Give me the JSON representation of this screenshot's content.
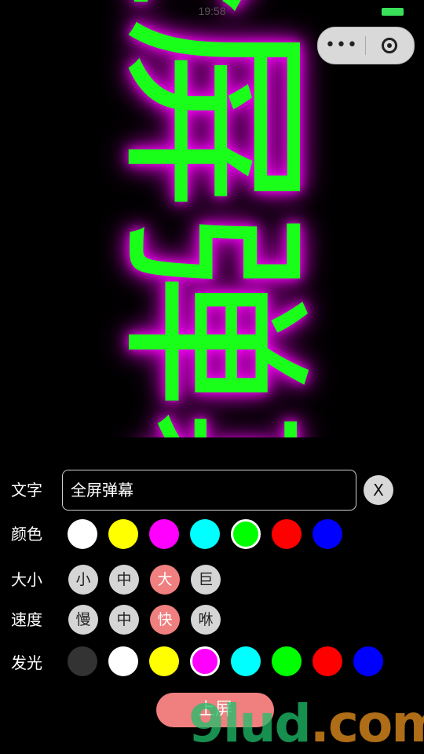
{
  "status": {
    "time": "19:58"
  },
  "preview": {
    "danmaku_text": "全屏弹幕",
    "text_color": "#19ff19",
    "glow_color": "#ff00ff"
  },
  "controls": {
    "text": {
      "label": "文字",
      "value": "全屏弹幕",
      "clear_label": "X"
    },
    "color": {
      "label": "颜色",
      "options": [
        "#ffffff",
        "#ffff00",
        "#ff00ff",
        "#00ffff",
        "#00ff00",
        "#ff0000",
        "#0000ff"
      ],
      "selected": "#00ff00"
    },
    "size": {
      "label": "大小",
      "options": [
        "小",
        "中",
        "大",
        "巨"
      ],
      "selected": "大"
    },
    "speed": {
      "label": "速度",
      "options": [
        "慢",
        "中",
        "快",
        "咻"
      ],
      "selected": "快"
    },
    "glow": {
      "label": "发光",
      "options": [
        "#333333",
        "#ffffff",
        "#ffff00",
        "#ff00ff",
        "#00ffff",
        "#00ff00",
        "#ff0000",
        "#0000ff"
      ],
      "selected": "#ff00ff"
    },
    "submit_label": "上屏"
  },
  "watermark": {
    "brand": "9lud",
    "suffix": ".com"
  }
}
